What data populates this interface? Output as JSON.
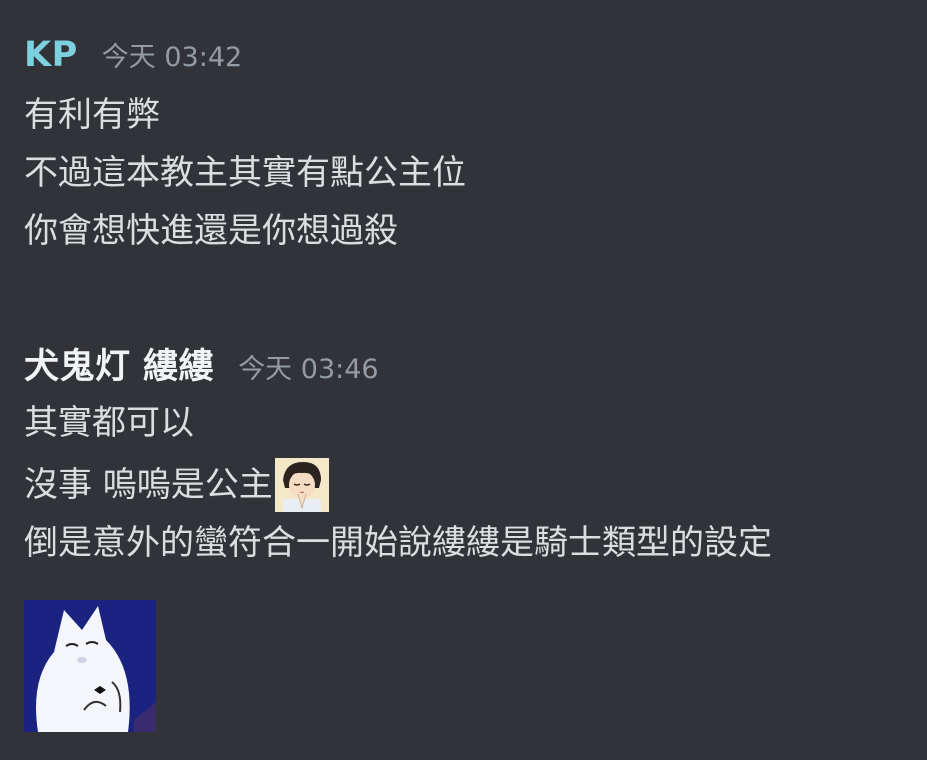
{
  "messages": [
    {
      "author": "KP",
      "author_color": "#7dd1df",
      "timestamp": "今天 03:42",
      "lines": [
        "有利有弊",
        "不過這本教主其實有點公主位",
        "你會想快進還是你想過殺"
      ]
    },
    {
      "author": "犬鬼灯 縷縷",
      "author_color": "#f2f3f5",
      "timestamp": "今天 03:46",
      "lines": [
        "其實都可以",
        "沒事 嗚嗚是公主",
        "倒是意外的蠻符合一開始說縷縷是騎士類型的設定"
      ],
      "inline_emoji": "praying-anime-boy-emoji",
      "sticker": "white-creature-sticker"
    }
  ],
  "colors": {
    "background": "#313338",
    "text": "#dbdee1",
    "timestamp": "#949ba4"
  }
}
